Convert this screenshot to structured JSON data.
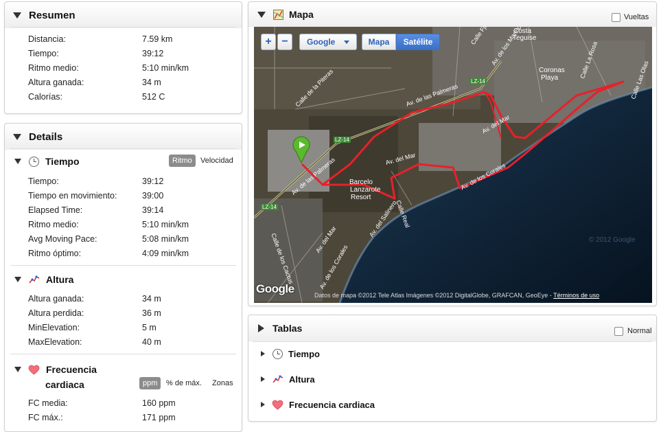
{
  "resumen": {
    "title": "Resumen",
    "rows": [
      {
        "label": "Distancia:",
        "value": "7.59 km"
      },
      {
        "label": "Tiempo:",
        "value": "39:12"
      },
      {
        "label": "Ritmo medio:",
        "value": "5:10 min/km"
      },
      {
        "label": "Altura ganada:",
        "value": "34 m"
      },
      {
        "label": "Calorías:",
        "value": "512 C"
      }
    ]
  },
  "details": {
    "title": "Details",
    "tiempo": {
      "title": "Tiempo",
      "toggle_on": "Ritmo",
      "toggle_off": "Velocidad",
      "rows": [
        {
          "label": "Tiempo:",
          "value": "39:12"
        },
        {
          "label": "Tiempo en movimiento:",
          "value": "39:00"
        },
        {
          "label": "Elapsed Time:",
          "value": "39:14"
        },
        {
          "label": "Ritmo medio:",
          "value": "5:10 min/km"
        },
        {
          "label": "Avg Moving Pace:",
          "value": "5:08 min/km"
        },
        {
          "label": "Ritmo óptimo:",
          "value": "4:09 min/km"
        }
      ]
    },
    "altura": {
      "title": "Altura",
      "rows": [
        {
          "label": "Altura ganada:",
          "value": "34 m"
        },
        {
          "label": "Altura perdida:",
          "value": "36 m"
        },
        {
          "label": "MinElevation:",
          "value": "5 m"
        },
        {
          "label": "MaxElevation:",
          "value": "40 m"
        }
      ]
    },
    "fc": {
      "title_line1": "Frecuencia",
      "title_line2": "cardiaca",
      "toggle_on": "ppm",
      "toggle_pct": "% de máx.",
      "toggle_zonas": "Zonas",
      "rows": [
        {
          "label": "FC media:",
          "value": "160 ppm"
        },
        {
          "label": "FC máx.:",
          "value": "171 ppm"
        }
      ]
    }
  },
  "mapa": {
    "title": "Mapa",
    "vueltas_label": "Vueltas",
    "zoom_in": "+",
    "zoom_out": "−",
    "provider": "Google",
    "map_btn": "Mapa",
    "sat_btn": "Satélite",
    "google_logo": "Google",
    "attribution": "Datos de mapa ©2012 Tele Atlas Imágenes ©2012 DigitalGlobe, GRAFCAN, GeoEye -",
    "terms": "Términos de uso",
    "labels": {
      "costa1": "Costa",
      "costa2": "Teguise",
      "coronas1": "Coronas",
      "coronas2": "Playa",
      "barcelo1": "Barcelo",
      "barcelo2": "Lanzarote",
      "barcelo3": "Resort",
      "lz14a": "LZ-14",
      "lz14b": "LZ-14",
      "lz14c": "LZ-14",
      "av_palmeras1": "Av. de las Palmeras",
      "av_palmeras2": "Av. de las Palmeras",
      "av_mar1": "Av. del Mar",
      "av_mar2": "Av. del Mar",
      "av_mar3": "Av. del Mar",
      "av_corales1": "Av. de los Corales",
      "av_corales2": "Av. de los Corales",
      "calle_piteras": "Calle de la Piteras",
      "calle_salinero": "Av. del Salinero",
      "calle_real": "Calle Real",
      "calle_cactus": "Calle de los Cactus",
      "calle_olas": "Calle Las Olas",
      "av_marinos": "Av. de los Marinos",
      "calle_rosa": "Calle La Rosa",
      "calle_fjords": "Calle Fjords",
      "faded": "© 2012 Google"
    }
  },
  "tablas": {
    "title": "Tablas",
    "normal_label": "Normal",
    "items": [
      "Tiempo",
      "Altura",
      "Frecuencia cardiaca"
    ]
  },
  "colors": {
    "route": "#e8202a",
    "sea": "#0d2338",
    "land": "#4a4534",
    "accent": "#2a62b8"
  }
}
